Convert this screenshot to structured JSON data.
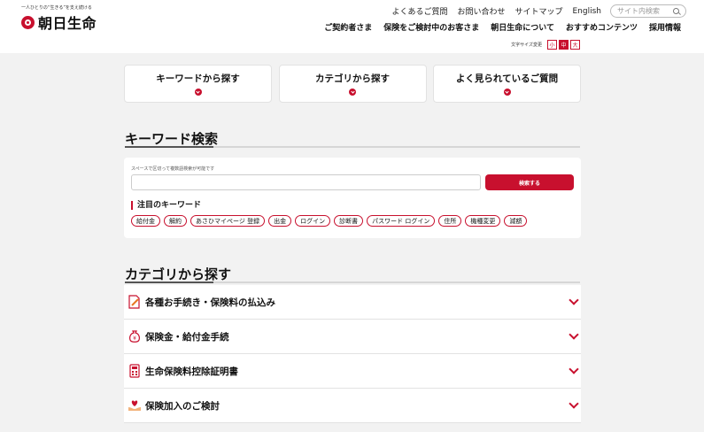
{
  "header": {
    "tagline": "一人ひとりの“生きる”を支え続ける",
    "logo_text": "朝日生命",
    "util_links": [
      "よくあるご質問",
      "お問い合わせ",
      "サイトマップ",
      "English"
    ],
    "search_placeholder": "サイト内検索",
    "main_nav": [
      "ご契約者さま",
      "保険をご検討中のお客さま",
      "朝日生命について",
      "おすすめコンテンツ",
      "採用情報"
    ],
    "font_size_label": "文字サイズ変更",
    "font_sizes": [
      "小",
      "中",
      "大"
    ],
    "font_size_selected": "中"
  },
  "tabs": [
    "キーワードから探す",
    "カテゴリから探す",
    "よく見られているご質問"
  ],
  "keyword_section": {
    "title": "キーワード検索",
    "hint": "スペースで区切って複数語検索が可能です",
    "button": "検索する",
    "input_value": "",
    "featured_heading": "注目のキーワード",
    "keywords": [
      "給付金",
      "解約",
      "あさひマイページ 登録",
      "出金",
      "ログイン",
      "診断書",
      "パスワード ログイン",
      "住所",
      "機種変更",
      "減額"
    ]
  },
  "category_section": {
    "title": "カテゴリから探す",
    "items": [
      {
        "label": "各種お手続き・保険料の払込み",
        "icon": "document-pen-icon"
      },
      {
        "label": "保険金・給付金手続",
        "icon": "yen-bag-icon"
      },
      {
        "label": "生命保険料控除証明書",
        "icon": "calculator-icon"
      },
      {
        "label": "保険加入のご検討",
        "icon": "heart-hands-icon"
      }
    ]
  },
  "colors": {
    "accent": "#c8102e",
    "background": "#f2f2f2"
  }
}
